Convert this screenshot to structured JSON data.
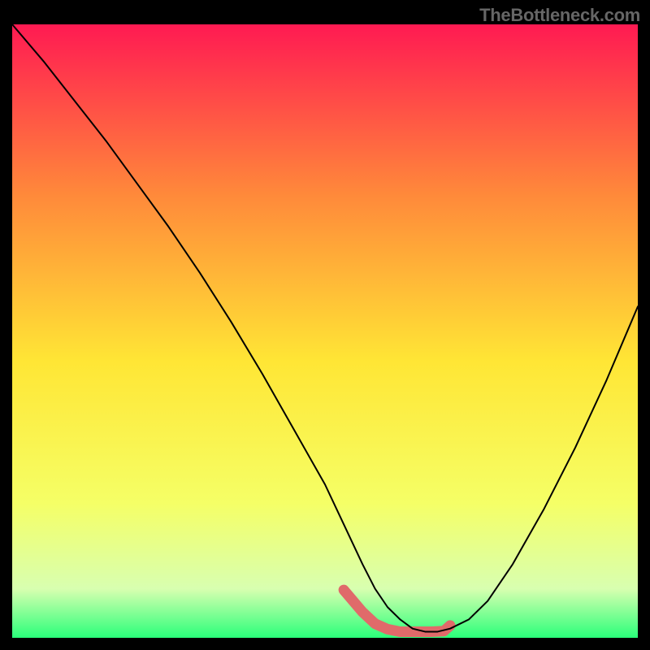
{
  "watermark": "TheBottleneck.com",
  "chart_data": {
    "type": "line",
    "title": "",
    "xlabel": "",
    "ylabel": "",
    "xlim": [
      0,
      100
    ],
    "ylim": [
      0,
      100
    ],
    "background_gradient": {
      "top": "#ff1a52",
      "mid_upper": "#ff8a3a",
      "mid": "#ffe635",
      "mid_lower": "#f5ff66",
      "low": "#d8ffb0",
      "bottom": "#2aff7a"
    },
    "series": [
      {
        "name": "bottleneck-curve",
        "color": "#000000",
        "stroke_width": 2,
        "x": [
          0,
          5,
          10,
          15,
          20,
          25,
          30,
          35,
          40,
          45,
          50,
          53,
          56,
          58,
          60,
          62,
          64,
          66,
          68,
          70,
          73,
          76,
          80,
          85,
          90,
          95,
          100
        ],
        "values": [
          100,
          94,
          87.5,
          81,
          74,
          67,
          59.5,
          51.5,
          43,
          34,
          25,
          18.5,
          12,
          8,
          5,
          3,
          1.5,
          1,
          1,
          1.5,
          3,
          6,
          12,
          21,
          31,
          42,
          54
        ]
      }
    ],
    "highlight_band": {
      "name": "optimal-zone-marker",
      "color": "#e06a6a",
      "stroke_width": 13,
      "x": [
        53,
        56,
        58,
        60,
        62,
        63,
        65,
        67,
        69,
        70
      ],
      "values": [
        7.8,
        4.2,
        2.3,
        1.4,
        1.0,
        1.0,
        1.0,
        1.0,
        1.1,
        2.0
      ]
    }
  }
}
